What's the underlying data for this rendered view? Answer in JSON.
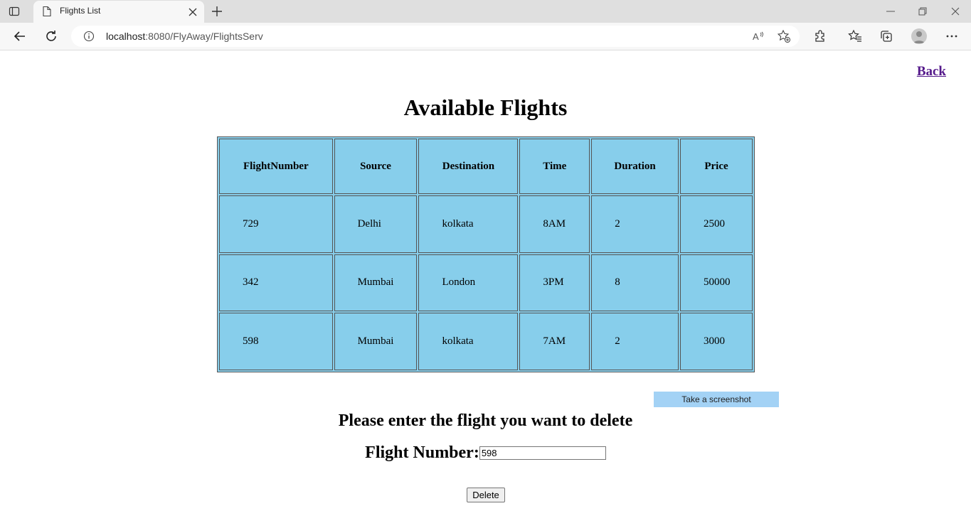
{
  "browser": {
    "tab_title": "Flights List",
    "url_host": "localhost",
    "url_path": ":8080/FlyAway/FlightsServ"
  },
  "page": {
    "back_link": "Back",
    "title": "Available Flights",
    "screenshot_button": "Take a screenshot",
    "delete_prompt": "Please enter the flight you want to delete",
    "flight_number_label": "Flight Number:",
    "flight_number_value": "598",
    "delete_button": "Delete"
  },
  "table": {
    "headers": [
      "FlightNumber",
      "Source",
      "Destination",
      "Time",
      "Duration",
      "Price"
    ],
    "rows": [
      [
        "729",
        "Delhi",
        "kolkata",
        "8AM",
        "2",
        "2500"
      ],
      [
        "342",
        "Mumbai",
        "London",
        "3PM",
        "8",
        "50000"
      ],
      [
        "598",
        "Mumbai",
        "kolkata",
        "7AM",
        "2",
        "3000"
      ]
    ]
  },
  "colors": {
    "table_bg": "#87ceeb",
    "link_visited": "#551a8b"
  },
  "icons": [
    "tab-actions-icon",
    "page-icon",
    "close-icon",
    "plus-icon",
    "minimize-icon",
    "restore-icon",
    "back-arrow-icon",
    "refresh-icon",
    "info-icon",
    "read-aloud-icon",
    "add-favorite-icon",
    "extensions-icon",
    "favorites-icon",
    "collections-icon",
    "profile-icon",
    "more-icon"
  ]
}
